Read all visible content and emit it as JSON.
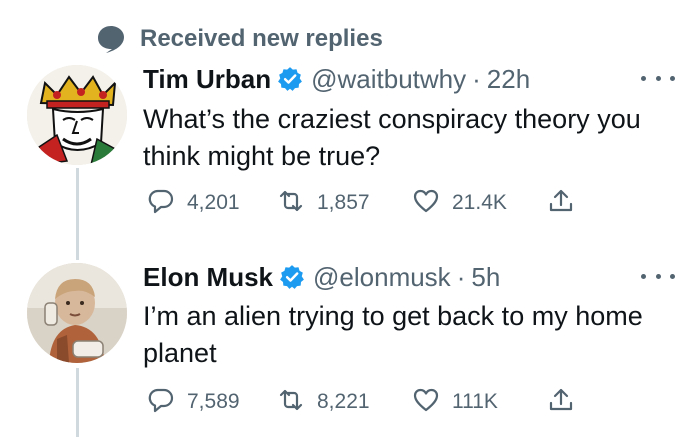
{
  "notice": {
    "text": "Received new replies",
    "icon": "comment-bubble-icon"
  },
  "tweets": [
    {
      "name": "Tim Urban",
      "handle": "@waitbutwhy",
      "separator": "·",
      "time": "22h",
      "text": "What’s the craziest conspiracy theory you think might be true?",
      "counts": {
        "replies": "4,201",
        "retweets": "1,857",
        "likes": "21.4K"
      },
      "avatar": "king-of-hearts-card"
    },
    {
      "name": "Elon Musk",
      "handle": "@elonmusk",
      "separator": "·",
      "time": "5h",
      "text": "I’m an alien trying to get back to my home planet",
      "counts": {
        "replies": "7,589",
        "retweets": "8,221",
        "likes": "111K"
      },
      "avatar": "child-with-phone-photo"
    }
  ],
  "colors": {
    "text": "#0f1419",
    "muted": "#536471",
    "verified": "#1d9bf0",
    "thread_line": "#cfd9de"
  }
}
